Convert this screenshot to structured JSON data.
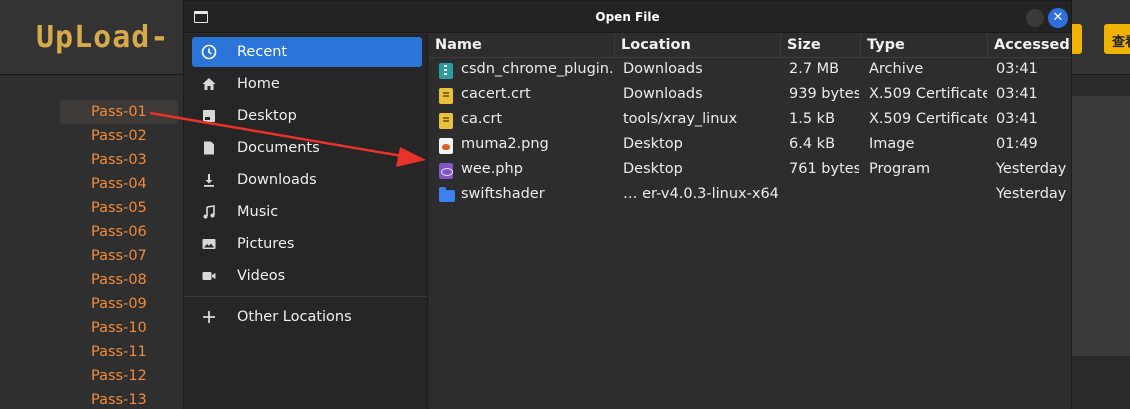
{
  "background_page": {
    "logo": "UpLoad-",
    "view_button_label": "查看",
    "pass_items": [
      "Pass-01",
      "Pass-02",
      "Pass-03",
      "Pass-04",
      "Pass-05",
      "Pass-06",
      "Pass-07",
      "Pass-08",
      "Pass-09",
      "Pass-10",
      "Pass-11",
      "Pass-12",
      "Pass-13"
    ],
    "active_item": "Pass-01"
  },
  "dialog": {
    "title": "Open File",
    "close_glyph": "✕"
  },
  "places": [
    {
      "label": "Recent",
      "icon": "clock-icon",
      "selected": true
    },
    {
      "label": "Home",
      "icon": "home-icon"
    },
    {
      "label": "Desktop",
      "icon": "desktop-icon"
    },
    {
      "label": "Documents",
      "icon": "document-icon"
    },
    {
      "label": "Downloads",
      "icon": "download-icon"
    },
    {
      "label": "Music",
      "icon": "music-icon"
    },
    {
      "label": "Pictures",
      "icon": "picture-icon"
    },
    {
      "label": "Videos",
      "icon": "video-icon"
    },
    {
      "label": "Other Locations",
      "icon": "plus-icon"
    }
  ],
  "columns": [
    "Name",
    "Location",
    "Size",
    "Type",
    "Accessed"
  ],
  "files": [
    {
      "name": "csdn_chrome_plugin...",
      "location": "Downloads",
      "size": "2.7 MB",
      "type": "Archive",
      "accessed": "03:41",
      "icon": "archive"
    },
    {
      "name": "cacert.crt",
      "location": "Downloads",
      "size": "939 bytes",
      "type": "X.509 Certificate",
      "accessed": "03:41",
      "icon": "doc"
    },
    {
      "name": "ca.crt",
      "location": "tools/xray_linux",
      "size": "1.5 kB",
      "type": "X.509 Certificate",
      "accessed": "03:41",
      "icon": "doc"
    },
    {
      "name": "muma2.png",
      "location": "Desktop",
      "size": "6.4 kB",
      "type": "Image",
      "accessed": "01:49",
      "icon": "image"
    },
    {
      "name": "wee.php",
      "location": "Desktop",
      "size": "761 bytes",
      "type": "Program",
      "accessed": "Yesterday",
      "icon": "php"
    },
    {
      "name": "swiftshader",
      "location": "… er-v4.0.3-linux-x64",
      "size": "",
      "type": "",
      "accessed": "Yesterday",
      "icon": "folder"
    }
  ],
  "colors": {
    "accent": "#2b75d8",
    "pass_text": "#f08a3c",
    "annotation_arrow": "#e8322a",
    "logo": "#d6a94a"
  }
}
